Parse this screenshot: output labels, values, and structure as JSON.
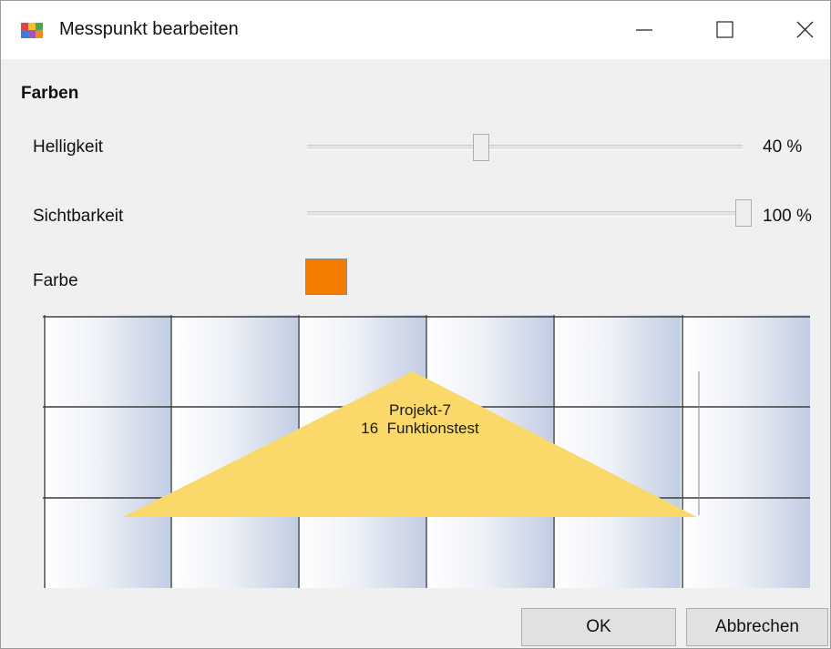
{
  "window": {
    "title": "Messpunkt bearbeiten",
    "icons": {
      "app": "app-icon",
      "minimize": "minimize-icon",
      "maximize": "maximize-icon",
      "close": "close-icon"
    }
  },
  "section": {
    "title": "Farben"
  },
  "brightness": {
    "label": "Helligkeit",
    "value_text": "40 %",
    "level": 0.4
  },
  "visibility": {
    "label": "Sichtbarkeit",
    "value_text": "100 %",
    "level": 1.0
  },
  "color": {
    "label": "Farbe",
    "value": "#f57c00"
  },
  "preview": {
    "line1": "Projekt-7",
    "line2": "16  Funktionstest",
    "fill": "#fad96a"
  },
  "buttons": {
    "ok": "OK",
    "cancel": "Abbrechen"
  }
}
